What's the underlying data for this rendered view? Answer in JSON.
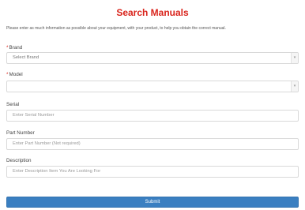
{
  "page": {
    "title": "Search Manuals",
    "intro": "Please enter as much information as possible about your equipment, with your product, to help you obtain the correct manual."
  },
  "form": {
    "brand": {
      "label": "Brand",
      "required_mark": "*",
      "selected": "Select Brand"
    },
    "model": {
      "label": "Model",
      "required_mark": "*",
      "selected": ""
    },
    "serial": {
      "label": "Serial",
      "placeholder": "Enter Serial Number"
    },
    "part_number": {
      "label": "Part Number",
      "placeholder": "Enter Part Number (Not required)"
    },
    "description": {
      "label": "Description",
      "placeholder": "Enter Description Item You Are Looking For"
    },
    "submit_label": "Submit"
  },
  "icons": {
    "select_arrow": "chevron-down-icon"
  }
}
